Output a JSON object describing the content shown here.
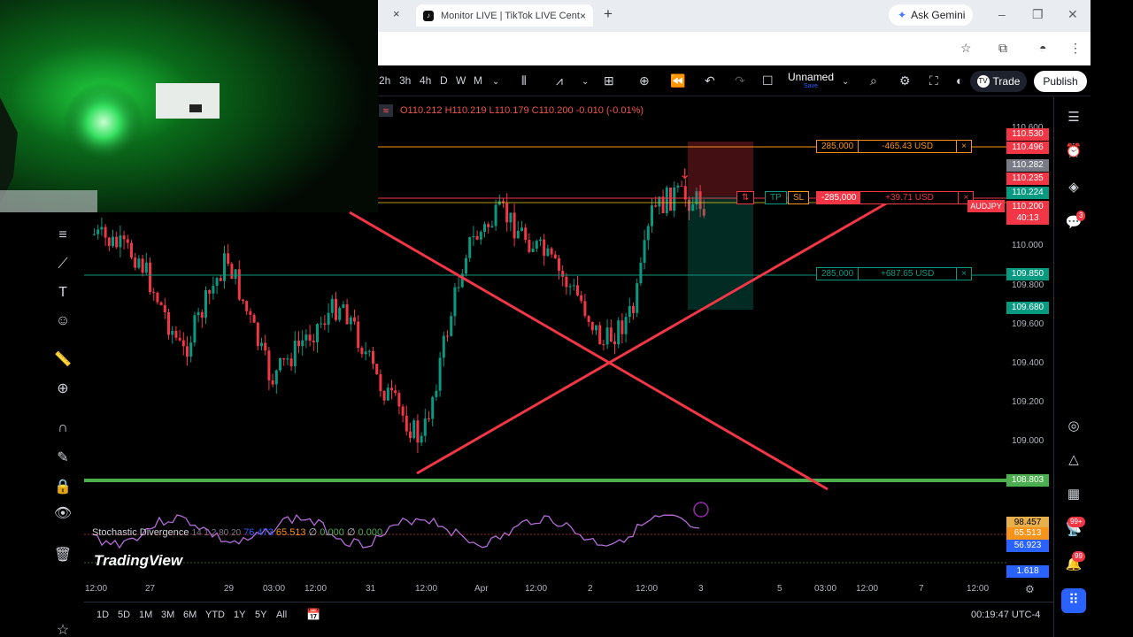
{
  "browser": {
    "tab_title": "Monitor LIVE | TikTok LIVE Cent",
    "tab_close": "×",
    "new_tab": "+",
    "gemini_label": "Ask Gemini",
    "win_min": "–",
    "win_max": "❐",
    "win_close": "✕"
  },
  "toolbar": {
    "intervals": [
      "2h",
      "3h",
      "4h",
      "D",
      "W",
      "M"
    ],
    "layout_name": "Unnamed",
    "layout_sub": "Save",
    "trade_label": "Trade",
    "publish_label": "Publish"
  },
  "ohlc": {
    "o": "O110.212",
    "h": "H110.219",
    "l": "L110.179",
    "c": "C110.200",
    "chg": "-0.010 (-0.01%)"
  },
  "price_axis": {
    "ticks": [
      "110.600",
      "110.000",
      "109.800",
      "109.600",
      "109.400",
      "109.200",
      "109.000"
    ],
    "tags": [
      {
        "v": "110.530",
        "color": "#f23645"
      },
      {
        "v": "110.496",
        "color": "#f23645"
      },
      {
        "v": "110.282",
        "color": "#787b86"
      },
      {
        "v": "110.235",
        "color": "#f23645"
      },
      {
        "v": "110.224",
        "color": "#089981"
      },
      {
        "v": "110.200",
        "color": "#f23645"
      },
      {
        "v": "40:13",
        "color": "#f23645"
      },
      {
        "v": "109.850",
        "color": "#089981"
      },
      {
        "v": "109.680",
        "color": "#089981"
      },
      {
        "v": "108.803",
        "color": "#4caf50"
      }
    ],
    "symbol_tag": "AUDJPY"
  },
  "orders": {
    "sl": {
      "qty": "285,000",
      "pnl": "-465.43 USD",
      "x": "×"
    },
    "pos": {
      "qty": "-285,000",
      "pnl": "+39.71 USD",
      "x": "×",
      "tp": "TP",
      "sl": "SL",
      "rev": "⇅"
    },
    "tp": {
      "qty": "285,000",
      "pnl": "+687.65 USD",
      "x": "×"
    }
  },
  "indicator": {
    "name": "Stochastic Divergence",
    "params": "14 1 2 80 20",
    "v1": "76.473",
    "v2": "65.513",
    "z1": "∅",
    "v3": "0.000",
    "z2": "∅",
    "v4": "0.000",
    "axis": [
      "98.457",
      "65.513",
      "56.923",
      "1.618"
    ]
  },
  "x_axis": [
    "12:00",
    "27",
    "29",
    "03:00",
    "12:00",
    "31",
    "12:00",
    "Apr",
    "12:00",
    "2",
    "12:00",
    "3",
    "5",
    "03:00",
    "12:00",
    "7",
    "12:00"
  ],
  "timeframes": [
    "1D",
    "5D",
    "1M",
    "3M",
    "6M",
    "YTD",
    "1Y",
    "5Y",
    "All"
  ],
  "clock": "00:19:47 UTC-4",
  "brand": "TradingView",
  "badges": {
    "chat": "3",
    "alerts": "99+",
    "notif": "99"
  }
}
